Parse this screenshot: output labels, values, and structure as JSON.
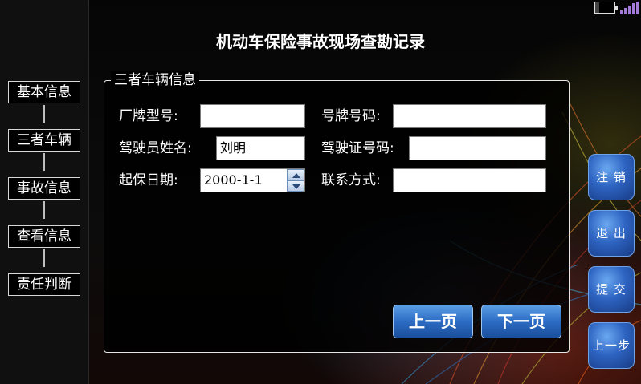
{
  "title": "机动车保险事故现场查勘记录",
  "sidebar": {
    "items": [
      {
        "label": "基本信息"
      },
      {
        "label": "三者车辆"
      },
      {
        "label": "事故信息"
      },
      {
        "label": "查看信息"
      },
      {
        "label": "责任判断"
      }
    ]
  },
  "panel": {
    "legend": "三者车辆信息",
    "fields": {
      "plate_type": {
        "label": "厂牌型号:",
        "value": ""
      },
      "plate_number": {
        "label": "号牌号码:",
        "value": ""
      },
      "driver_name": {
        "label": "驾驶员姓名:",
        "value": "刘明"
      },
      "license_number": {
        "label": "驾驶证号码:",
        "value": ""
      },
      "insure_date": {
        "label": "起保日期:",
        "value": "2000-1-1"
      },
      "contact": {
        "label": "联系方式:",
        "value": ""
      }
    },
    "prev_page": "上一页",
    "next_page": "下一页"
  },
  "actions": {
    "logout": "注 销",
    "exit": "退 出",
    "submit": "提 交",
    "prev_step": "上一步"
  },
  "status": {
    "battery_icon": "battery-icon",
    "signal_icon": "signal-icon"
  }
}
